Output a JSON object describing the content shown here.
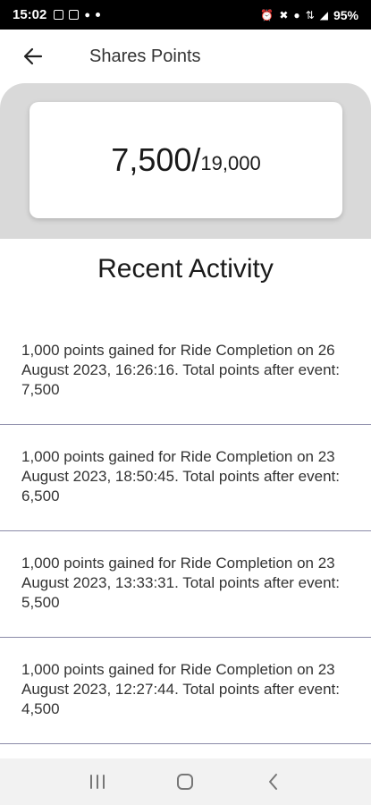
{
  "status_bar": {
    "time": "15:02",
    "battery": "95%",
    "left_icons": [
      "gallery-icon",
      "b-app-icon",
      "bulb-icon",
      "dot-icon"
    ],
    "right_icons": [
      "alarm-icon",
      "mute-icon",
      "location-icon",
      "data-icon",
      "signal-icon"
    ]
  },
  "header": {
    "back_icon": "arrow-left-icon",
    "title": "Shares Points"
  },
  "points": {
    "current": "7,500",
    "separator": "/",
    "total": "19,000"
  },
  "recent_activity": {
    "title": "Recent Activity",
    "items": [
      {
        "text": "1,000 points gained for Ride Completion on 26 August 2023, 16:26:16. Total points after event: 7,500"
      },
      {
        "text": "1,000 points gained for Ride Completion on 23 August 2023, 18:50:45. Total points after event: 6,500"
      },
      {
        "text": "1,000 points gained for Ride Completion on 23 August 2023, 13:33:31. Total points after event: 5,500"
      },
      {
        "text": "1,000 points gained for Ride Completion on 23 August 2023, 12:27:44. Total points after event: 4,500"
      }
    ]
  },
  "nav_bar": {
    "buttons": [
      "recent-apps-icon",
      "home-icon",
      "back-nav-icon"
    ]
  },
  "colors": {
    "panel_bg": "#d9d9d9",
    "divider": "#8a8aa8",
    "status_bar_bg": "#000000"
  }
}
